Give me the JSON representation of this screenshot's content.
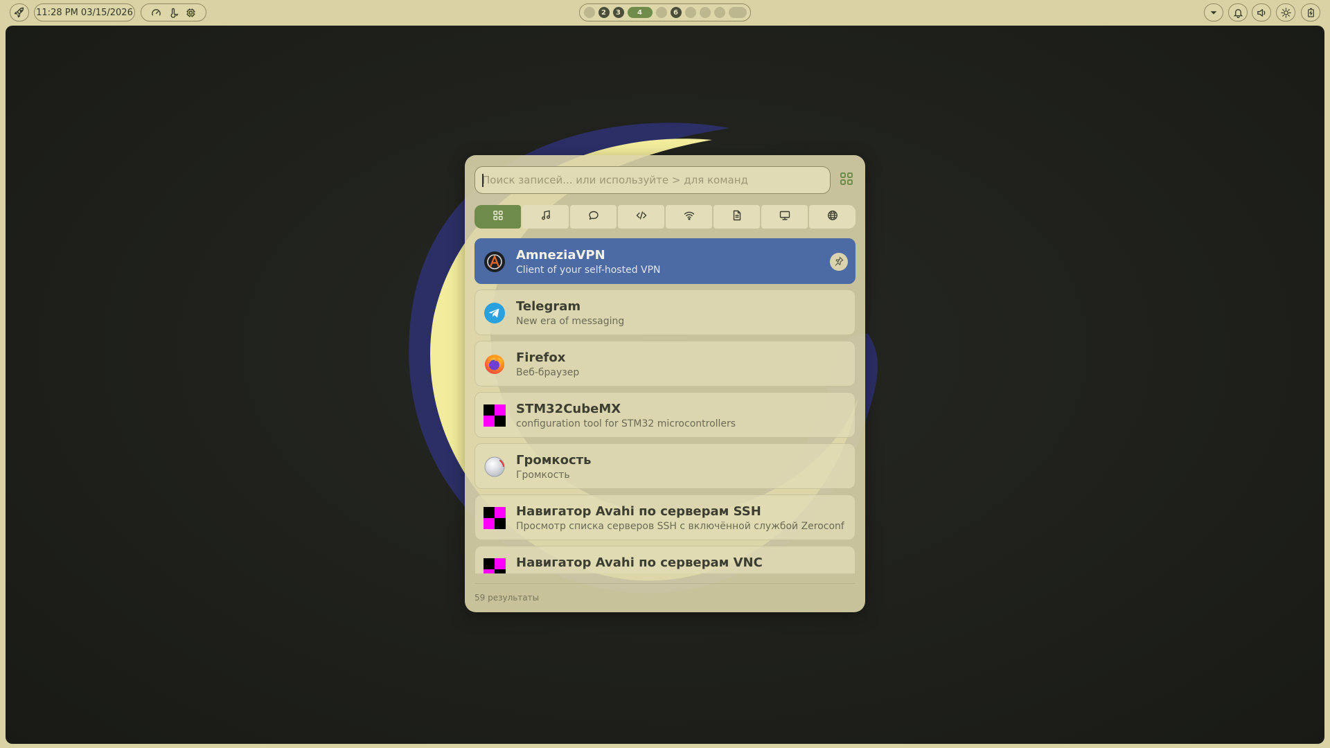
{
  "topbar": {
    "clock": "11:28 PM 03/15/2026",
    "workspaces": [
      {
        "label": "",
        "state": "empty"
      },
      {
        "label": "2",
        "state": "occupied"
      },
      {
        "label": "3",
        "state": "occupied"
      },
      {
        "label": "4",
        "state": "active"
      },
      {
        "label": "",
        "state": "empty"
      },
      {
        "label": "6",
        "state": "occupied"
      },
      {
        "label": "",
        "state": "empty"
      },
      {
        "label": "",
        "state": "empty"
      },
      {
        "label": "",
        "state": "empty"
      },
      {
        "label": "",
        "state": "empty"
      }
    ],
    "icons": {
      "launcher": "rocket-icon",
      "gauge": "gauge-icon",
      "temperature": "thermometer-icon",
      "cpu": "cpu-icon",
      "dropdown": "chevron-down-icon",
      "notifications": "bell-icon",
      "volume": "speaker-icon",
      "brightness": "sun-icon",
      "power": "battery-icon"
    }
  },
  "launcher": {
    "search": {
      "placeholder": "Поиск записей... или используйте > для команд",
      "value": ""
    },
    "tabs": [
      {
        "icon": "apps-grid-icon",
        "active": true
      },
      {
        "icon": "music-note-icon",
        "active": false
      },
      {
        "icon": "chat-bubble-icon",
        "active": false
      },
      {
        "icon": "code-icon",
        "active": false
      },
      {
        "icon": "wifi-icon",
        "active": false
      },
      {
        "icon": "document-icon",
        "active": false
      },
      {
        "icon": "monitor-icon",
        "active": false
      },
      {
        "icon": "globe-icon",
        "active": false
      }
    ],
    "results": [
      {
        "title": "AmneziaVPN",
        "subtitle": "Client of your self-hosted VPN",
        "icon": "amneziavpn-icon",
        "selected": true
      },
      {
        "title": "Telegram",
        "subtitle": "New era of messaging",
        "icon": "telegram-icon",
        "selected": false
      },
      {
        "title": "Firefox",
        "subtitle": "Веб-браузер",
        "icon": "firefox-icon",
        "selected": false
      },
      {
        "title": "STM32CubeMX",
        "subtitle": "configuration tool for STM32 microcontrollers",
        "icon": "missing-icon",
        "selected": false
      },
      {
        "title": "Громкость",
        "subtitle": "Громкость",
        "icon": "volume-knob-icon",
        "selected": false
      },
      {
        "title": "Навигатор Avahi по серверам SSH",
        "subtitle": "Просмотр списка серверов SSH с включённой службой Zeroconf",
        "icon": "missing-icon",
        "selected": false
      },
      {
        "title": "Навигатор Avahi по серверам VNC",
        "subtitle": "",
        "icon": "missing-icon",
        "selected": false
      }
    ],
    "count": "59 результаты"
  },
  "colors": {
    "bar": "#d8d2a4",
    "accent": "#6e8b4a",
    "selected": "#4c6aa3",
    "wallpaper_moon": "#f2ec9c",
    "wallpaper_shadow": "#2c2f66"
  }
}
